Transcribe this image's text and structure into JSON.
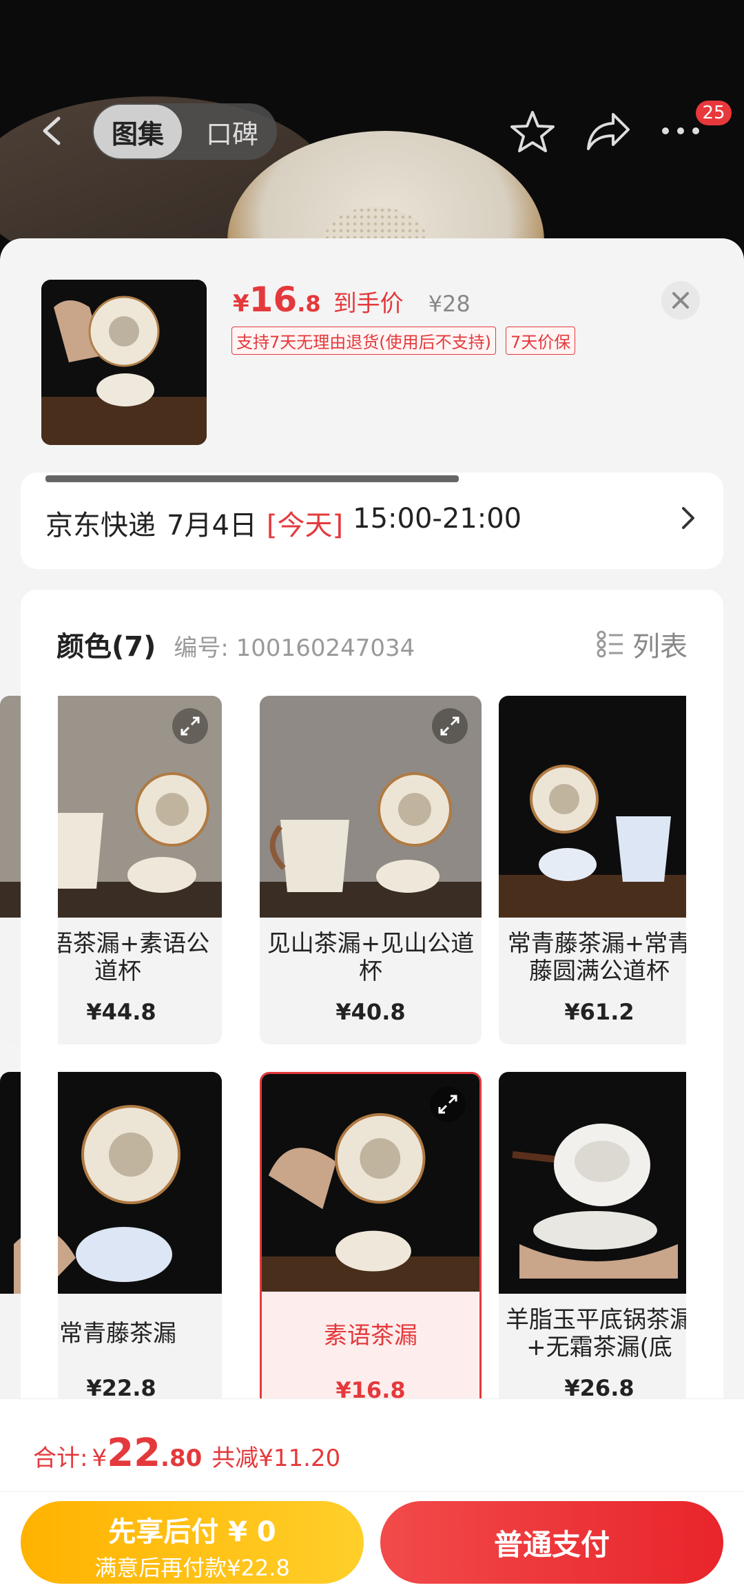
{
  "nav": {
    "tab_active": "图集",
    "tab_inactive": "口碑",
    "badge_count": "25"
  },
  "summary": {
    "currency": "¥",
    "price_int": "16",
    "price_dec": ".8",
    "price_label": "到手价",
    "original_price": "¥28",
    "tags": [
      "支持7天无理由退货(使用后不支持)",
      "7天价保"
    ]
  },
  "delivery": {
    "cut_text": "…",
    "carrier": "京东快递",
    "date": "7月4日",
    "today": "[今天]",
    "window": "15:00-21:00"
  },
  "options": {
    "title": "颜色(7)",
    "code": "编号: 100160247034",
    "list_label": "列表",
    "items": [
      {
        "name": "素语茶漏+素语公道杯",
        "price": "¥44.8",
        "selected": false
      },
      {
        "name": "见山茶漏+见山公道杯",
        "price": "¥40.8",
        "selected": false
      },
      {
        "name": "常青藤茶漏+常青藤圆满公道杯",
        "price": "¥61.2",
        "selected": false
      },
      {
        "name": "常青藤茶漏",
        "price": "¥22.8",
        "selected": false
      },
      {
        "name": "素语茶漏",
        "price": "¥16.8",
        "selected": true
      },
      {
        "name": "羊脂玉平底锅茶漏+无霜茶漏(底",
        "price": "¥26.8",
        "selected": false
      }
    ]
  },
  "footer": {
    "total_label": "合计:",
    "currency": "¥",
    "total_int": "22",
    "total_dec": ".80",
    "saved": "共减¥11.20",
    "later_line1": "先享后付 ¥ 0",
    "later_line2": "满意后再付款¥22.8",
    "pay_label": "普通支付"
  },
  "colors": {
    "accent": "#e4393c",
    "pay_later": "#ffbf17",
    "pay_normal": "#ee3436"
  }
}
